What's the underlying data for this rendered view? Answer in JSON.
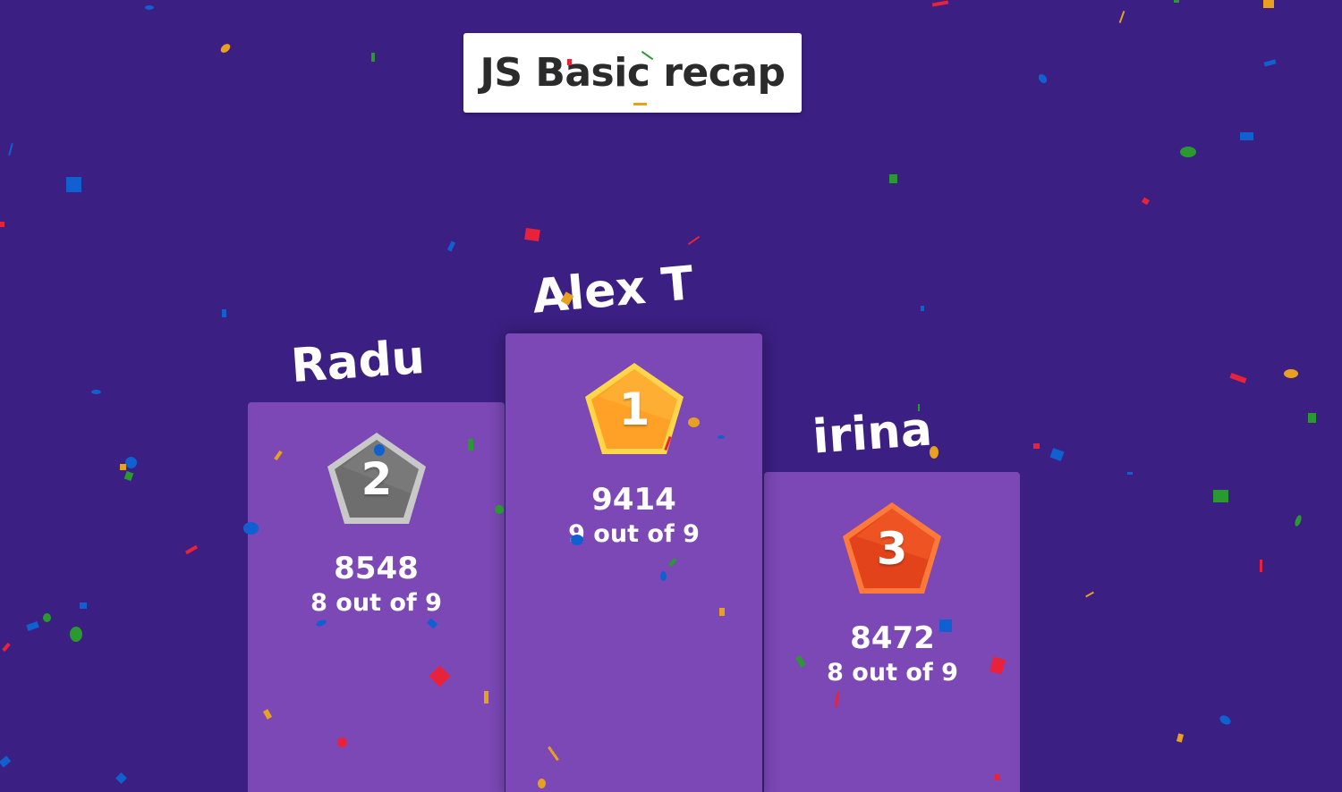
{
  "quiz": {
    "title": "JS Basic recap"
  },
  "podium": {
    "first": {
      "rank": "1",
      "name": "Alex T",
      "score": "9414",
      "correct": "9 out of 9"
    },
    "second": {
      "rank": "2",
      "name": "Radu",
      "score": "8548",
      "correct": "8 out of 9"
    },
    "third": {
      "rank": "3",
      "name": "irina",
      "score": "8472",
      "correct": "8 out of 9"
    }
  },
  "colors": {
    "background": "#3b1f82",
    "podium": "#7b48b5",
    "gold": "#ffaa2b",
    "silver": "#7a7a7a",
    "bronze": "#f0501e",
    "confetti": [
      "#e8223a",
      "#1060d0",
      "#2a9a30",
      "#e8a020"
    ]
  },
  "icons": [
    "gold-medal-icon",
    "silver-medal-icon",
    "bronze-medal-icon"
  ]
}
